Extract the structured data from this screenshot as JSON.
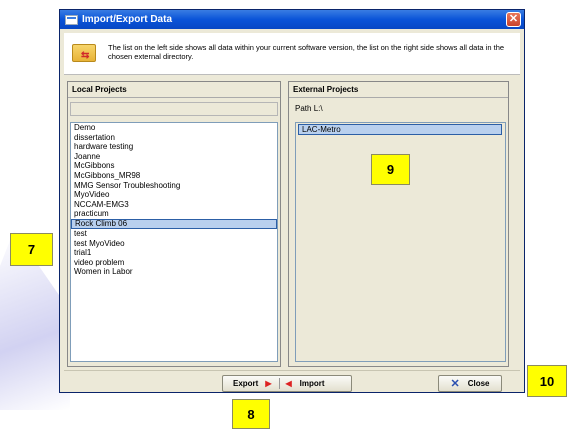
{
  "window": {
    "title": "Import/Export Data",
    "info_text": "The list on the left side shows all data within your current software version, the list on the right side shows all data in the chosen external directory."
  },
  "local_projects": {
    "header": "Local Projects",
    "items": [
      "Demo",
      "dissertation",
      "hardware testing",
      "Joanne",
      "McGibbons",
      "McGibbons_MR98",
      "MMG Sensor Troubleshooting",
      "MyoVideo",
      "NCCAM-EMG3",
      "practicum",
      "Rock Climb 06",
      "test",
      "test MyoVideo",
      "trial1",
      "video problem",
      "Women in Labor"
    ],
    "selected": "Rock Climb 06"
  },
  "external_projects": {
    "header": "External Projects",
    "path_label": "Path",
    "path_value": "L:\\",
    "items": [
      "LAC-Metro"
    ]
  },
  "buttons": {
    "export_label": "Export",
    "import_label": "Import",
    "close_label": "Close"
  },
  "callouts": [
    "7",
    "8",
    "9",
    "10"
  ],
  "colors": {
    "callout": "#ffff00",
    "selection": "#b9d0ee",
    "titlebar": "#0a54d8"
  }
}
